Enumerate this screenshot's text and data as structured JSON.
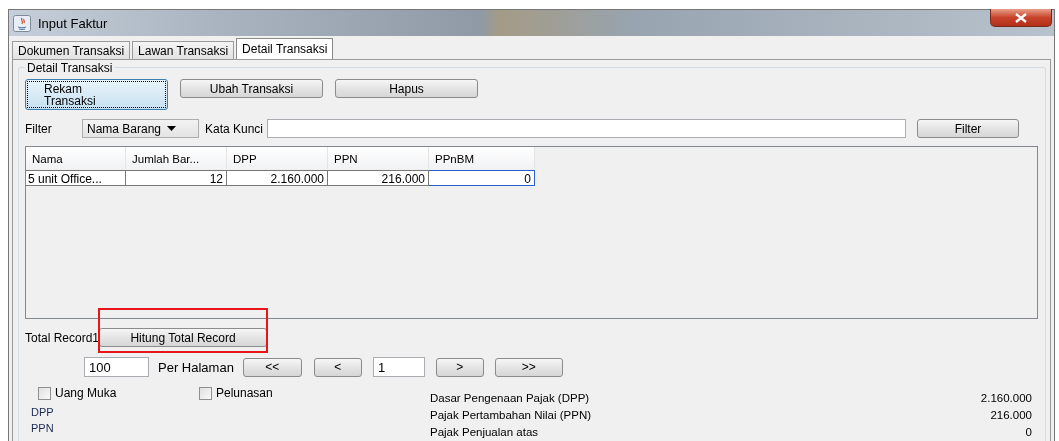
{
  "window": {
    "title": "Input Faktur"
  },
  "tabs": [
    {
      "label": "Dokumen Transaksi",
      "selected": false
    },
    {
      "label": "Lawan Transaksi",
      "selected": false
    },
    {
      "label": "Detail Transaksi",
      "selected": true
    }
  ],
  "group": {
    "title": "Detail Transaksi"
  },
  "actions": [
    {
      "label": "Rekam Transaksi",
      "focused": true
    },
    {
      "label": "Ubah Transaksi",
      "focused": false
    },
    {
      "label": "Hapus",
      "focused": false
    }
  ],
  "filter": {
    "label": "Filter",
    "field": "Nama Barang",
    "keyword_label": "Kata Kunci",
    "button": "Filter"
  },
  "table": {
    "columns": [
      "Nama",
      "Jumlah Bar...",
      "DPP",
      "PPN",
      "PPnBM"
    ],
    "rows": [
      {
        "cells": [
          "5 unit Office...",
          "12",
          "2.160.000",
          "216.000",
          "0"
        ]
      }
    ]
  },
  "total": {
    "label": "Total Record",
    "count": "1",
    "button": "Hitung Total Record",
    "highlighted": true
  },
  "pagination": {
    "page_size": "100",
    "per_page_label": "Per Halaman",
    "prev_buttons": [
      "<<",
      "<"
    ],
    "page": "1",
    "next_buttons": [
      ">",
      ">>"
    ]
  },
  "checkboxes": [
    {
      "label": "Uang Muka",
      "checked": false
    },
    {
      "label": "Pelunasan",
      "checked": false
    }
  ],
  "left_labels": [
    "DPP",
    "PPN"
  ],
  "summary": [
    {
      "label": "Dasar Pengenaan Pajak (DPP)",
      "value": "2.160.000"
    },
    {
      "label": "Pajak Pertambahan Nilai (PPN)",
      "value": "216.000"
    },
    {
      "label": "Pajak Penjualan atas",
      "value": "0"
    }
  ]
}
